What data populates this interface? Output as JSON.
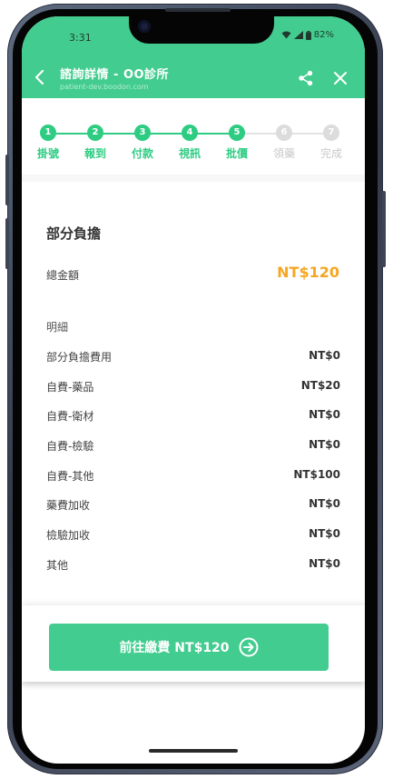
{
  "status_bar": {
    "time": "3:31",
    "battery": "82%"
  },
  "header": {
    "title": "諮詢詳情 - OO診所",
    "url": "patient-dev.boodon.com"
  },
  "stepper": {
    "steps": [
      {
        "number": "1",
        "label": "掛號",
        "done": true
      },
      {
        "number": "2",
        "label": "報到",
        "done": true
      },
      {
        "number": "3",
        "label": "付款",
        "done": true
      },
      {
        "number": "4",
        "label": "視訊",
        "done": true
      },
      {
        "number": "5",
        "label": "批價",
        "done": true
      },
      {
        "number": "6",
        "label": "領藥",
        "done": false
      },
      {
        "number": "7",
        "label": "完成",
        "done": false
      }
    ]
  },
  "payment": {
    "section_title": "部分負擔",
    "total_label": "總金額",
    "total_value": "NT$120",
    "detail_label": "明細",
    "items": [
      {
        "name": "部分負擔費用",
        "amount": "NT$0"
      },
      {
        "name": "自費-藥品",
        "amount": "NT$20"
      },
      {
        "name": "自費-衛材",
        "amount": "NT$0"
      },
      {
        "name": "自費-檢驗",
        "amount": "NT$0"
      },
      {
        "name": "自費-其他",
        "amount": "NT$100"
      },
      {
        "name": "藥費加收",
        "amount": "NT$0"
      },
      {
        "name": "檢驗加收",
        "amount": "NT$0"
      },
      {
        "name": "其他",
        "amount": "NT$0"
      }
    ]
  },
  "pay_button": {
    "label": "前往繳費 NT$120"
  },
  "colors": {
    "primary": "#43cc8f",
    "step_active": "#2ecc83",
    "step_inactive": "#dcdcdc",
    "total_amount": "#f5a623"
  },
  "icons": {
    "back": "chevron-left-icon",
    "share": "share-icon",
    "close": "close-icon",
    "arrow": "arrow-right-circle-icon"
  }
}
